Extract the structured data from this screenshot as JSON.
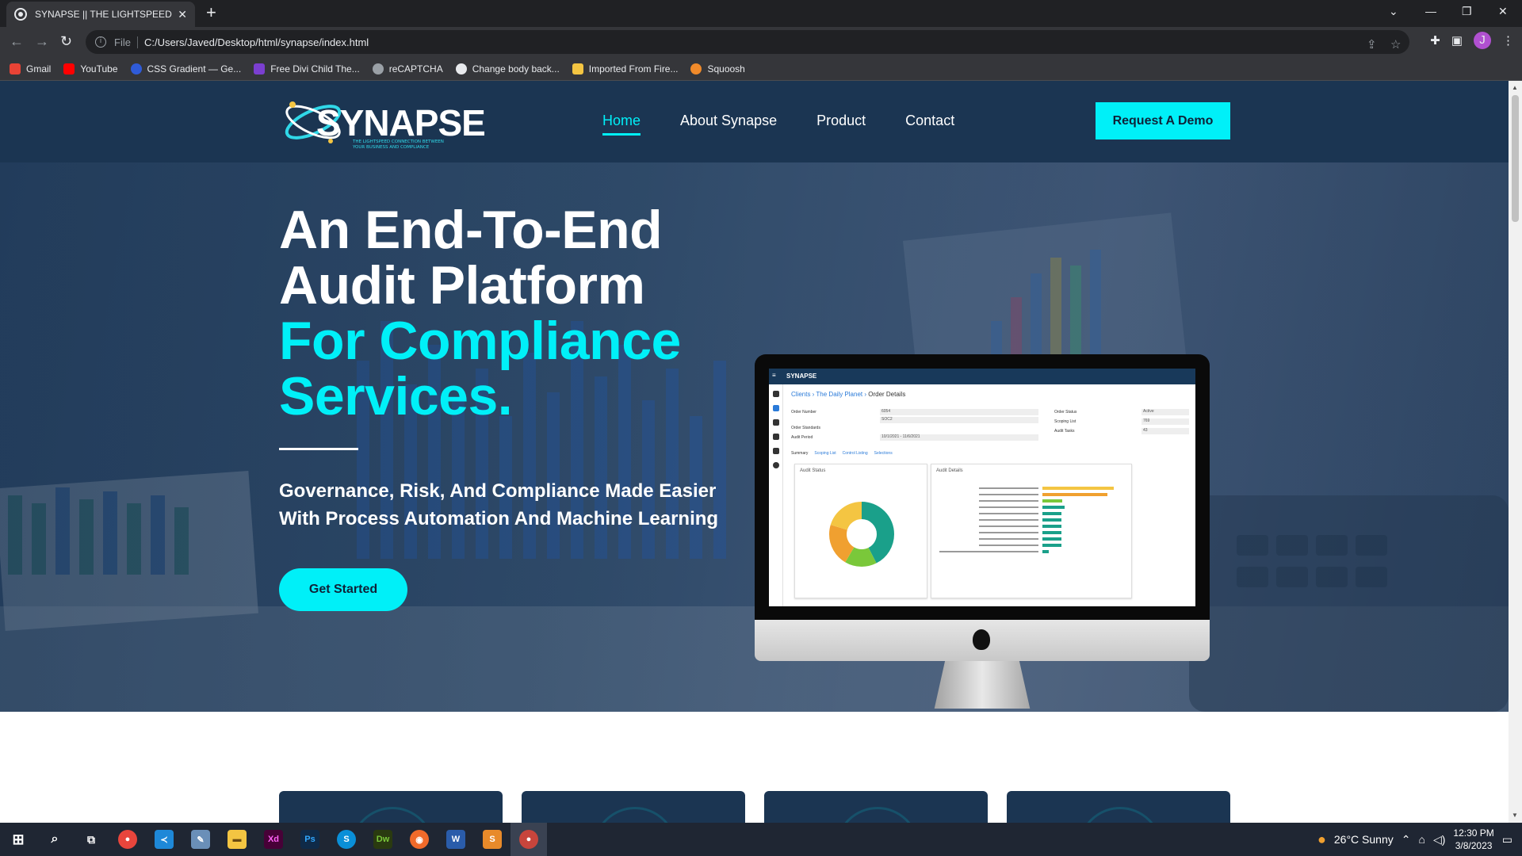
{
  "browser": {
    "tab_title": "SYNAPSE || THE LIGHTSPEED CONNECTION",
    "tab_close": "✕",
    "new_tab": "+",
    "scheme": "File",
    "url": "C:/Users/Javed/Desktop/html/synapse/index.html",
    "profile_initial": "J",
    "bookmarks": [
      {
        "label": "Gmail",
        "color": "#ea4335"
      },
      {
        "label": "YouTube",
        "color": "#ff0000"
      },
      {
        "label": "CSS Gradient — Ge...",
        "color": "#2f5bd8"
      },
      {
        "label": "Free Divi Child The...",
        "color": "#7b3fd0"
      },
      {
        "label": "reCAPTCHA",
        "color": "#9aa0a6"
      },
      {
        "label": "Change body back...",
        "color": "#e8eaed"
      },
      {
        "label": "Imported From Fire...",
        "color": "#f4c542"
      },
      {
        "label": "Squoosh",
        "color": "#f08a2a"
      }
    ]
  },
  "site": {
    "logo_text": "SYNAPSE",
    "logo_tagline": "THE LIGHTSPEED CONNECTION BETWEEN YOUR BUSINESS AND COMPLIANCE",
    "nav": [
      "Home",
      "About Synapse",
      "Product",
      "Contact"
    ],
    "demo_button": "Request A Demo",
    "hero": {
      "line1": "An End-To-End",
      "line2": "Audit Platform",
      "line3": "For Compliance",
      "line4": "Services.",
      "subtitle": "Governance, Risk, And Compliance Made Easier With Process Automation And Machine Learning",
      "cta": "Get Started"
    },
    "app_preview": {
      "logo": "SYNAPSE",
      "crumb1": "Clients",
      "crumb2": "The Daily Planet",
      "crumb3": "Order Details",
      "fields": [
        "Order Number",
        "Order Standards",
        "Audit Period",
        "Order Status",
        "Scoping List",
        "Audit Tasks"
      ],
      "values": [
        "6054",
        "SOC2",
        "10/1/2021 - 11/6/2021",
        "Active",
        "769",
        "43"
      ],
      "tabs": [
        "Summary",
        "Scoping List",
        "Control Listing",
        "Selections"
      ],
      "card1": "Audit Status",
      "card2": "Audit Details"
    },
    "colors": {
      "accent": "#00f0f8",
      "navy": "#1b3552"
    }
  },
  "taskbar": {
    "apps": [
      {
        "name": "chrome",
        "label": "●",
        "color": "#e8453c"
      },
      {
        "name": "vscode",
        "label": "≺",
        "color": "#1e88d8"
      },
      {
        "name": "notes",
        "label": "✎",
        "color": "#6a8fb8"
      },
      {
        "name": "explorer",
        "label": "▬",
        "color": "#f4c542"
      },
      {
        "name": "xd",
        "label": "Xd",
        "color": "#470137"
      },
      {
        "name": "photoshop",
        "label": "Ps",
        "color": "#0f2a48"
      },
      {
        "name": "skype",
        "label": "S",
        "color": "#0a8fd8"
      },
      {
        "name": "dreamweaver",
        "label": "Dw",
        "color": "#2a3a10"
      },
      {
        "name": "firefox",
        "label": "◉",
        "color": "#f06a2a"
      },
      {
        "name": "word",
        "label": "W",
        "color": "#2a5caa"
      },
      {
        "name": "sublime",
        "label": "S",
        "color": "#e88a2a"
      },
      {
        "name": "chrome-profile",
        "label": "●",
        "color": "#c8453c"
      }
    ],
    "weather": "26°C  Sunny",
    "time": "12:30 PM",
    "date": "3/8/2023"
  }
}
